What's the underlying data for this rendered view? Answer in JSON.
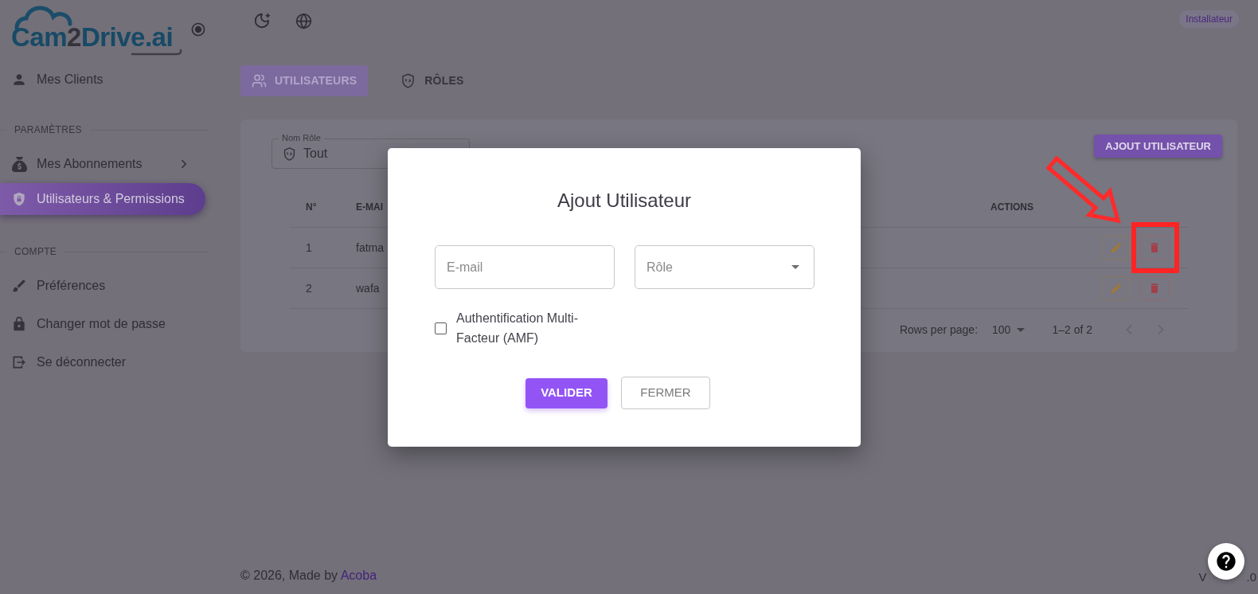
{
  "sidebar": {
    "logo": {
      "text_parts": [
        "Cam",
        "2",
        "Drive.ai"
      ]
    },
    "items": [
      {
        "label": "Mes Clients",
        "selected": false
      }
    ],
    "sections": [
      {
        "title": "PARAMÈTRES",
        "items": [
          {
            "label": "Mes Abonnements",
            "kind": "group",
            "selected": false
          },
          {
            "label": "Utilisateurs & Permissions",
            "kind": "link",
            "selected": true
          }
        ]
      },
      {
        "title": "COMPTE",
        "items": [
          {
            "label": "Préférences",
            "kind": "link",
            "selected": false
          },
          {
            "label": "Changer mot de passe",
            "kind": "link",
            "selected": false
          },
          {
            "label": "Se déconnecter",
            "kind": "link",
            "selected": false
          }
        ]
      }
    ]
  },
  "topbar": {
    "role_badge": "Installateur"
  },
  "tabs": [
    {
      "label": "UTILISATEURS",
      "selected": true
    },
    {
      "label": "RÔLES",
      "selected": false
    }
  ],
  "filter": {
    "label": "Nom Rôle",
    "value": "Tout"
  },
  "add_button": "AJOUT UTILISATEUR",
  "table": {
    "columns": [
      "N°",
      "E-MAI",
      "ACTIONS"
    ],
    "rows": [
      {
        "number": "1",
        "email": "fatma"
      },
      {
        "number": "2",
        "email": "wafa"
      }
    ]
  },
  "pagination": {
    "rows_per_page_label": "Rows per page:",
    "rows_per_page": "100",
    "range": "1–2 of 2",
    "previous": {
      "disabled": true
    },
    "next": {
      "disabled": true
    }
  },
  "dialog": {
    "title": "Ajout Utilisateur",
    "fields": [
      {
        "kind": "text",
        "placeholder": "E-mail"
      },
      {
        "kind": "select",
        "placeholder": "Rôle"
      }
    ],
    "checkbox": {
      "label": "Authentification Multi-Facteur (AMF)",
      "checked": false
    },
    "buttons": [
      {
        "label": "VALIDER",
        "kind": "primary"
      },
      {
        "label": "FERMER",
        "kind": "outlined"
      }
    ]
  },
  "footer": {
    "text": "© 2026, Made by",
    "link": "Acoba"
  },
  "version_parts": [
    "V",
    ".0"
  ]
}
